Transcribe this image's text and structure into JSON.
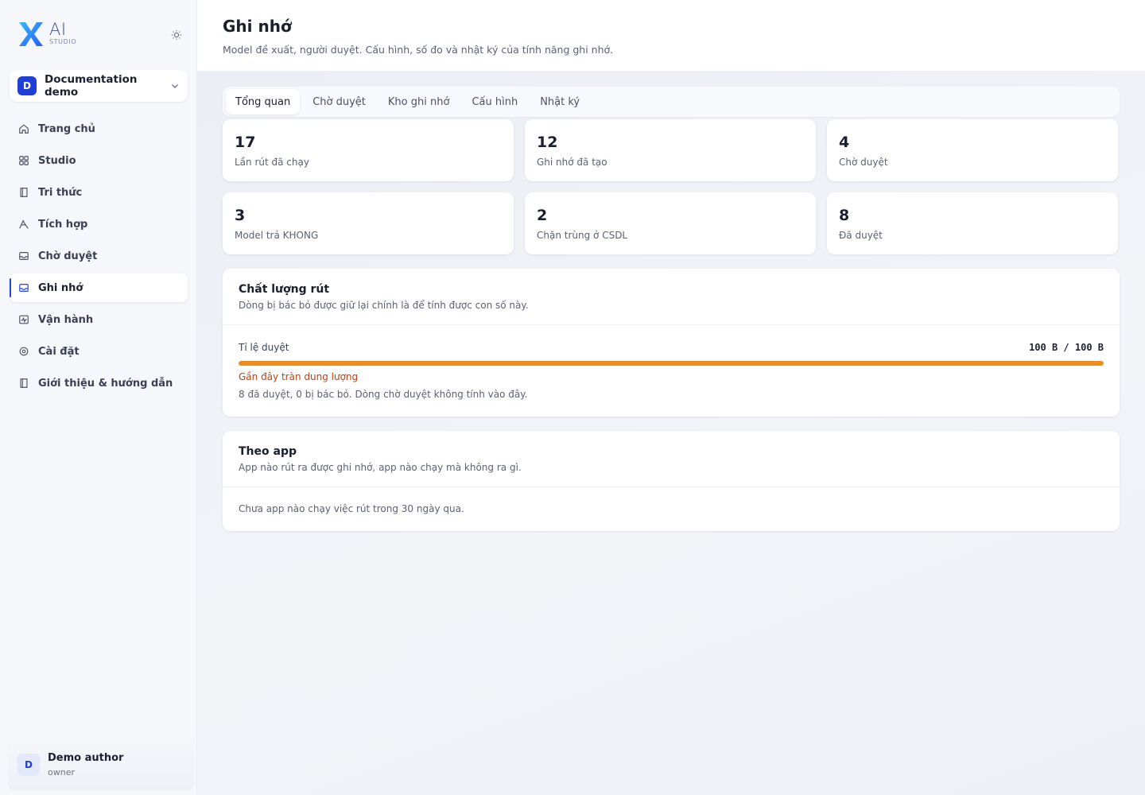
{
  "brand": {
    "logo_text": "AI",
    "logo_sub": "STUDIO",
    "accent": "#2746d8"
  },
  "workspace": {
    "avatar_letter": "D",
    "name": "Documentation demo"
  },
  "nav": {
    "items": [
      {
        "label": "Trang chủ",
        "icon": "home-icon"
      },
      {
        "label": "Studio",
        "icon": "grid-icon"
      },
      {
        "label": "Tri thức",
        "icon": "book-icon"
      },
      {
        "label": "Tích hợp",
        "icon": "integration-icon"
      },
      {
        "label": "Chờ duyệt",
        "icon": "inbox-icon"
      },
      {
        "label": "Ghi nhớ",
        "icon": "memory-icon",
        "active": true
      },
      {
        "label": "Vận hành",
        "icon": "activity-icon"
      },
      {
        "label": "Cài đặt",
        "icon": "settings-icon"
      },
      {
        "label": "Giới thiệu & hướng dẫn",
        "icon": "guide-icon"
      }
    ]
  },
  "user": {
    "avatar_letter": "D",
    "name": "Demo author",
    "role": "owner"
  },
  "header": {
    "title": "Ghi nhớ",
    "subtitle": "Model đề xuất, người duyệt. Cấu hình, số đo và nhật ký của tính năng ghi nhớ."
  },
  "tabs": [
    {
      "label": "Tổng quan",
      "active": true
    },
    {
      "label": "Chờ duyệt"
    },
    {
      "label": "Kho ghi nhớ"
    },
    {
      "label": "Cấu hình"
    },
    {
      "label": "Nhật ký"
    }
  ],
  "stats": [
    {
      "value": "17",
      "label": "Lần rút đã chạy"
    },
    {
      "value": "12",
      "label": "Ghi nhớ đã tạo"
    },
    {
      "value": "4",
      "label": "Chờ duyệt"
    },
    {
      "value": "3",
      "label": "Model trả KHONG"
    },
    {
      "value": "2",
      "label": "Chặn trùng ở CSDL"
    },
    {
      "value": "8",
      "label": "Đã duyệt"
    }
  ],
  "quality": {
    "title": "Chất lượng rút",
    "description": "Dòng bị bác bỏ được giữ lại chính là để tính được con số này.",
    "rate_label": "Tỉ lệ duyệt",
    "rate_value": "100 B / 100 B",
    "fill_fraction": 1.0,
    "fill_color": "#f08c1a",
    "warning": "Gần đây tràn dung lượng",
    "note": "8 đã duyệt, 0 bị bác bỏ. Dòng chờ duyệt không tính vào đây."
  },
  "by_app": {
    "title": "Theo app",
    "description": "App nào rút ra được ghi nhớ, app nào chạy mà không ra gì.",
    "empty": "Chưa app nào chạy việc rút trong 30 ngày qua."
  }
}
